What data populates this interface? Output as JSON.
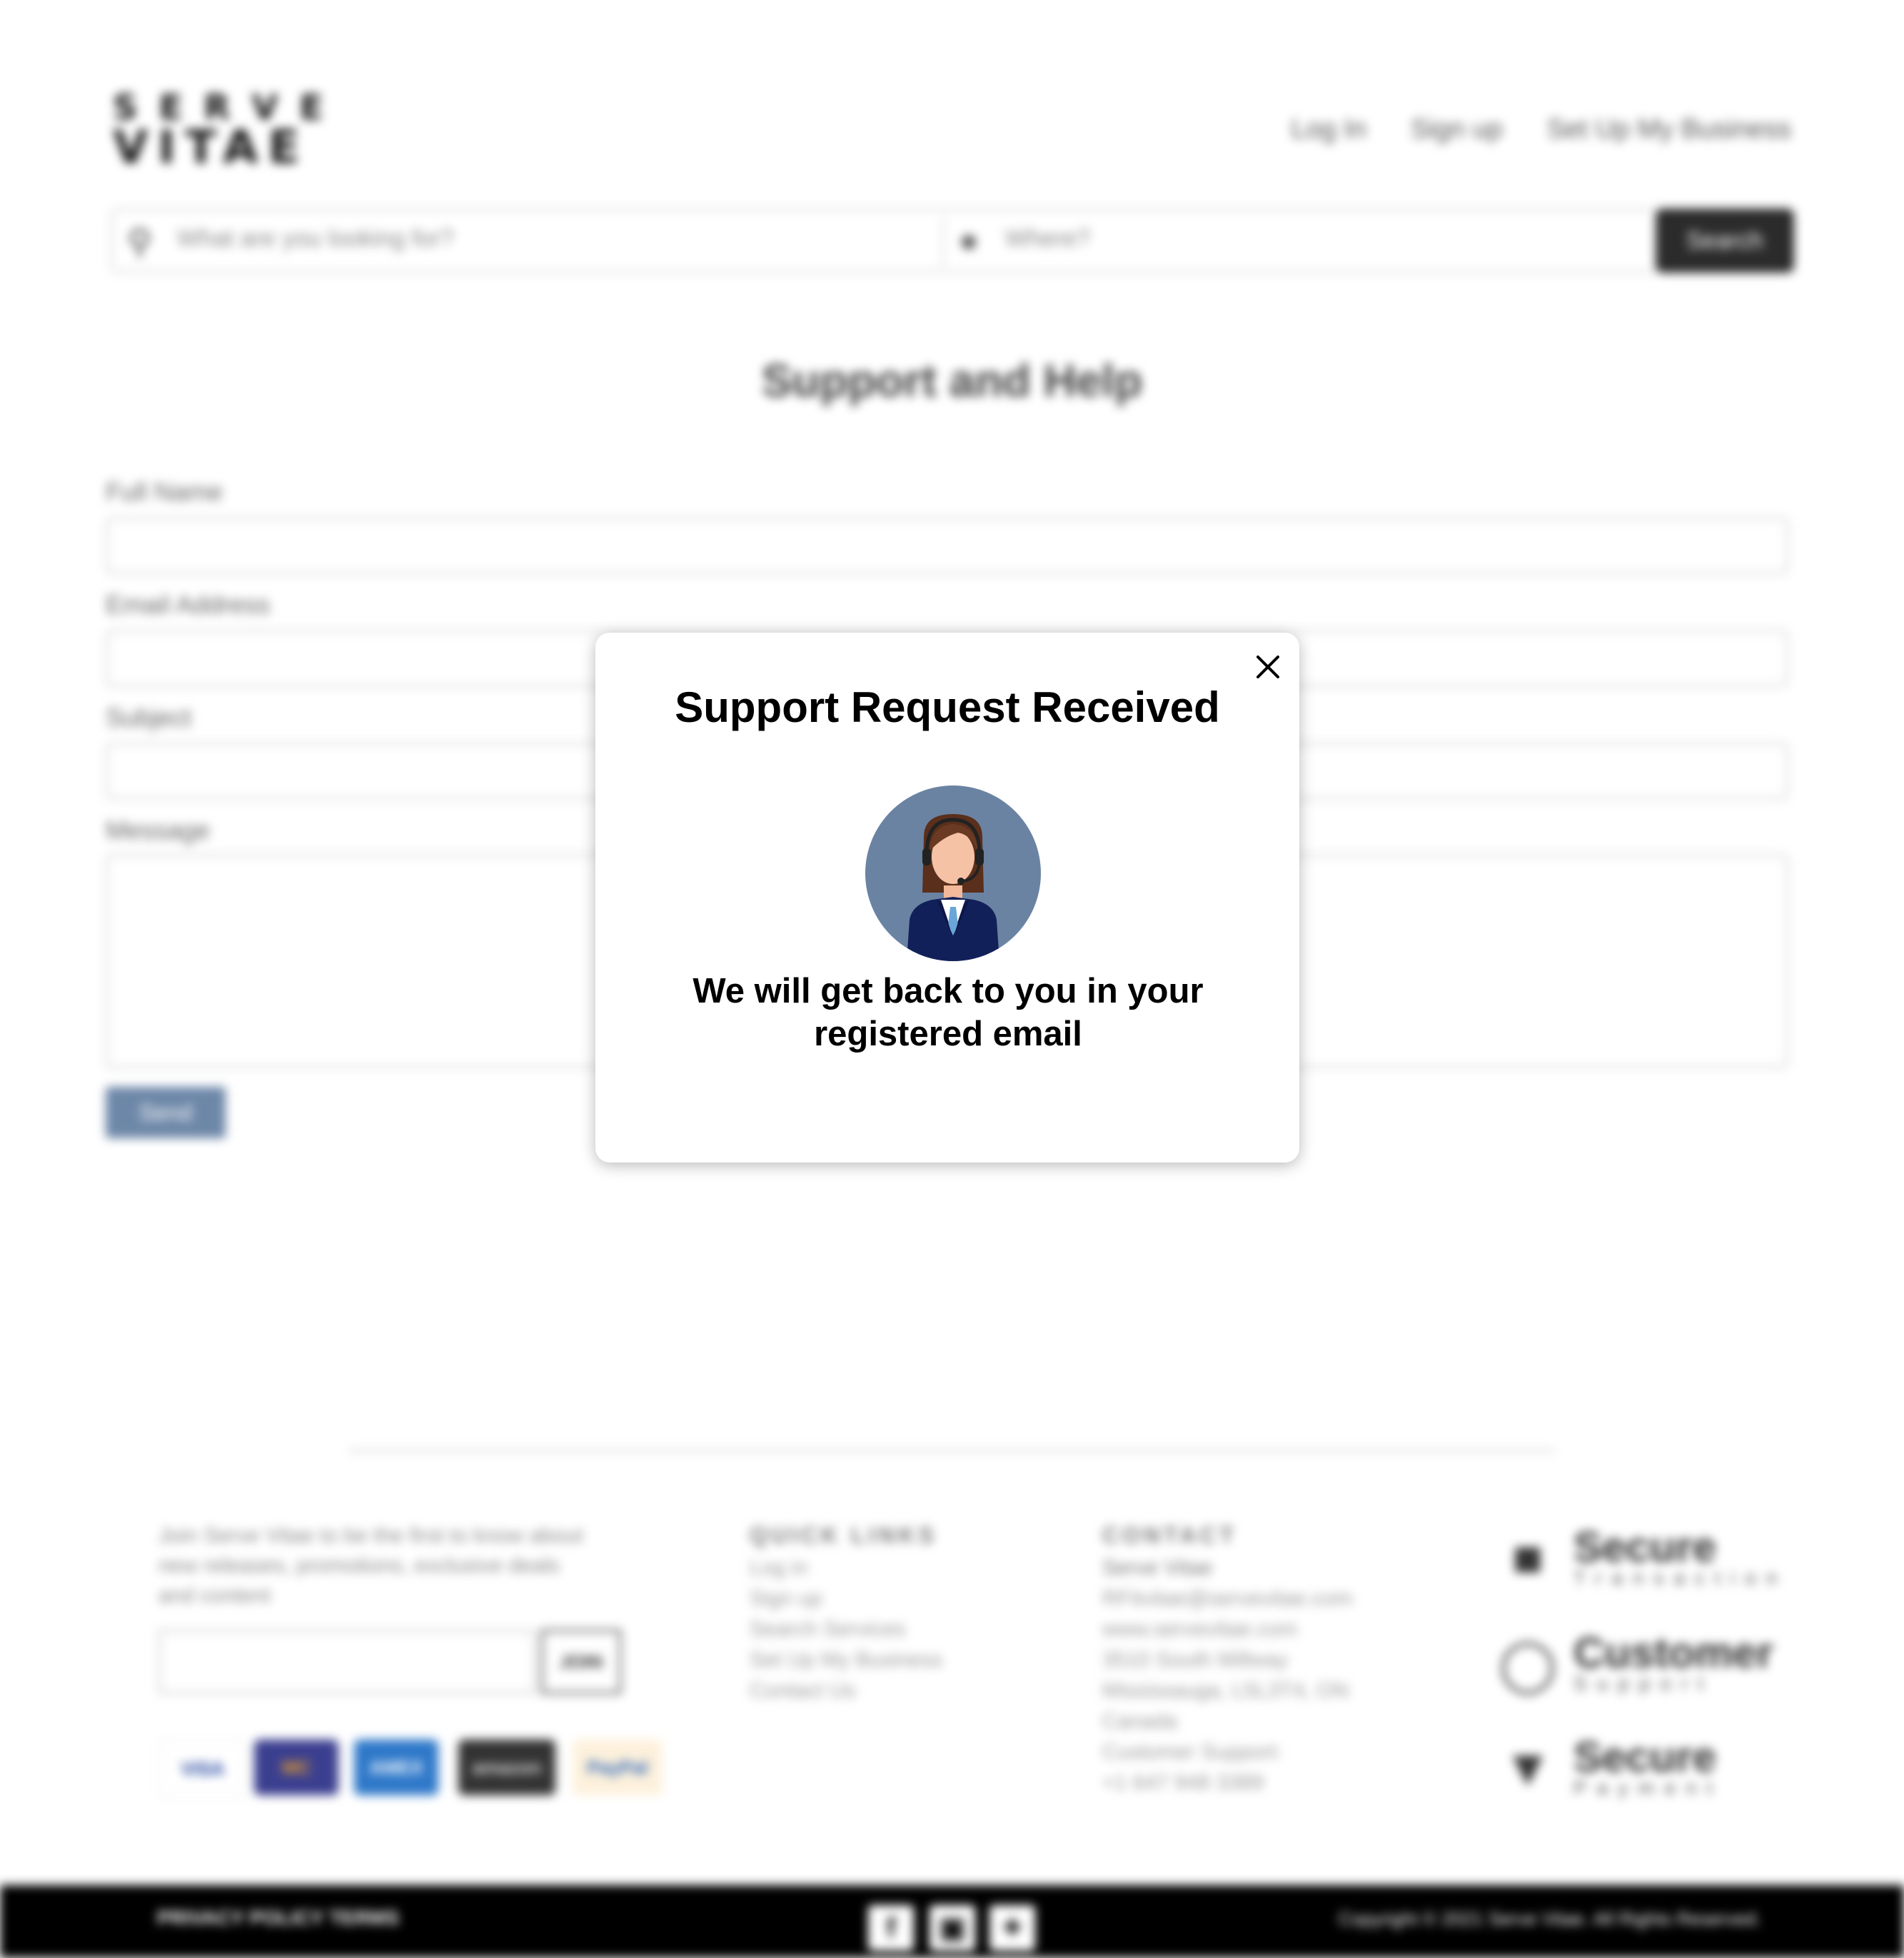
{
  "header": {
    "logo_line1": "SERVE",
    "logo_line2": "VITAE",
    "nav": [
      "Log In",
      "Sign up",
      "Set Up My Business"
    ]
  },
  "search": {
    "what_placeholder": "What are you looking for?",
    "where_placeholder": "Where?",
    "button": "Search"
  },
  "page_title": "Support and Help",
  "form": {
    "full_name_label": "Full Name",
    "email_label": "Email Address",
    "subject_label": "Subject",
    "message_label": "Message",
    "send_label": "Send"
  },
  "footer": {
    "newsletter_text": "Join Serve Vitae to be the first to know about new releases, promotions, exclusive deals and content",
    "join_label": "JOIN",
    "payments": [
      "VISA",
      "MC",
      "AMEX",
      "amazon",
      "PayPal"
    ],
    "quick_links_title": "QUICK LINKS",
    "quick_links": [
      "Log in",
      "Sign up",
      "Search Services",
      "Set Up My Business",
      "Contact Us"
    ],
    "contact_title": "CONTACT",
    "contact_lines": [
      "Serve Vitae",
      "RFitvitae@servevitae.com",
      "www.servevitae.com",
      "3510 South Millway",
      "Mississauga, L5L3T4, ON",
      "Canada",
      "Customer Support:",
      "+1 647 948 3389"
    ],
    "badges": [
      {
        "title": "Secure",
        "sub": "Transaction",
        "icon": "lock-icon"
      },
      {
        "title": "Customer",
        "sub": "Support",
        "icon": "24-7-icon"
      },
      {
        "title": "Secure",
        "sub": "Payment",
        "icon": "shield-check-icon"
      }
    ],
    "bottom_left": "PRIVACY POLICY   TERMS",
    "bottom_right": "Copyright © 2021 Serve Vitae. All Rights Reserved."
  },
  "modal": {
    "title": "Support Request Received",
    "message": "We will get back to you in your registered email",
    "close_icon": "close-icon",
    "avatar_icon": "support-agent-icon",
    "avatar_bg": "#6b83a3"
  }
}
